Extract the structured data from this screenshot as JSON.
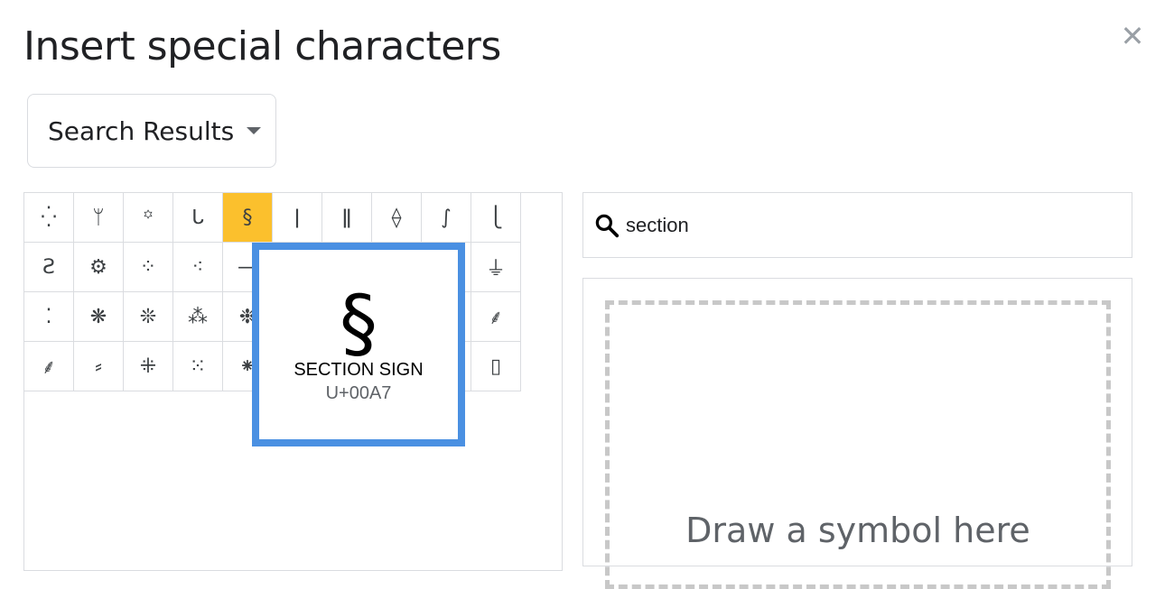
{
  "dialog": {
    "title": "Insert special characters",
    "close_label": "✕"
  },
  "category": {
    "selected": "Search Results"
  },
  "grid": {
    "cells": [
      "⁛",
      "ᛘ",
      "꙳",
      "ᒐ",
      "§",
      "ǀ",
      "ǁ",
      "⟠",
      "∫",
      "⎩",
      "Ƨ",
      "⚙",
      "⁘",
      "⁖",
      "—",
      "",
      "",
      "",
      "",
      "⏚",
      "⁚",
      "❋",
      "❊",
      "⁂",
      "❉",
      "",
      "",
      "",
      "",
      "⸙",
      "⸙",
      "⸗",
      "⁜",
      "⁙",
      "⁕",
      "",
      "",
      "",
      "",
      "▯"
    ],
    "selected_index": 4
  },
  "preview": {
    "glyph": "§",
    "name": "SECTION SIGN",
    "code": "U+00A7"
  },
  "search": {
    "value": "section"
  },
  "draw": {
    "placeholder": "Draw a symbol here"
  },
  "colors": {
    "selected_cell": "#fbc02d",
    "preview_border": "#4a90e2"
  }
}
